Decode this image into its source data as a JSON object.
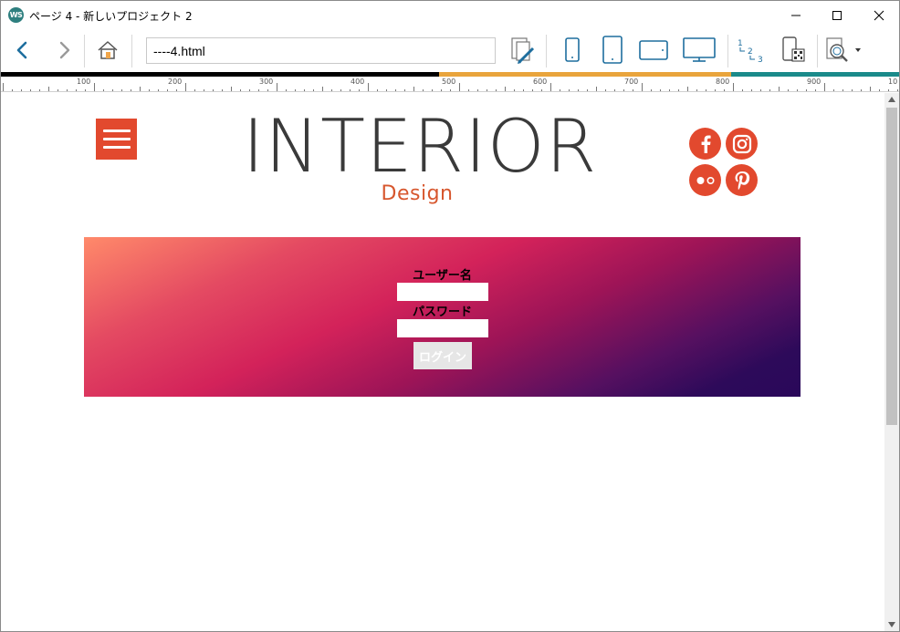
{
  "window": {
    "title": "ページ 4 - 新しいプロジェクト 2",
    "app_icon_text": "WS"
  },
  "toolbar": {
    "url_value": "----4.html",
    "accent_color": "#1e6e9e"
  },
  "progress_colors": [
    "#000000",
    "#e9a43c",
    "#1a8a8a"
  ],
  "ruler": {
    "labels": [
      "100",
      "200",
      "300",
      "400",
      "500",
      "600",
      "700",
      "800",
      "900",
      "10"
    ]
  },
  "page": {
    "logo_main": "INTERIOR",
    "logo_sub": "Design",
    "brand_color": "#e2492e",
    "social_icons": [
      "facebook-icon",
      "instagram-icon",
      "flickr-icon",
      "pinterest-icon"
    ],
    "login": {
      "username_label": "ユーザー名",
      "password_label": "パスワード",
      "username_value": "",
      "password_value": "",
      "button_label": "ログイン"
    }
  }
}
